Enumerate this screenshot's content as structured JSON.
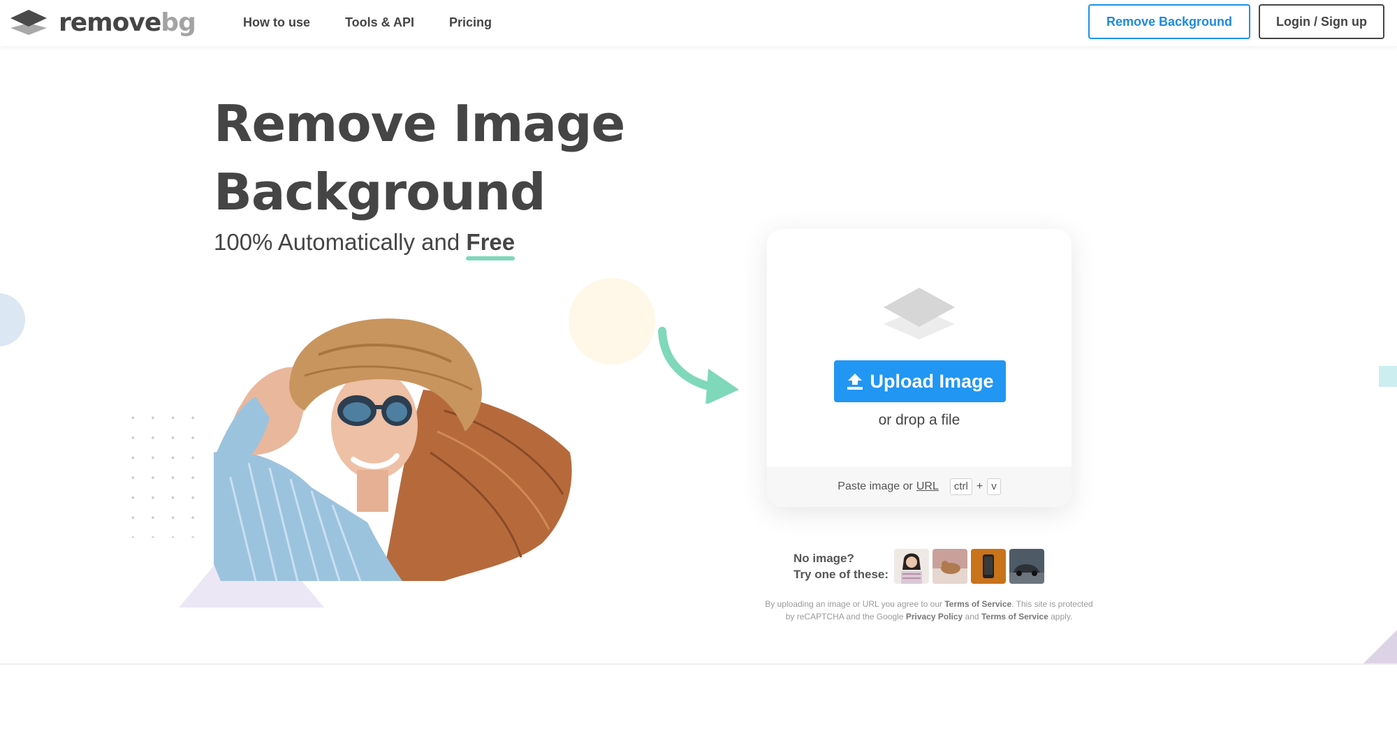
{
  "header": {
    "logo_main": "remove",
    "logo_accent": "bg",
    "nav": [
      "How to use",
      "Tools & API",
      "Pricing"
    ],
    "remove_bg_button": "Remove Background",
    "login_button": "Login / Sign up"
  },
  "hero": {
    "title_line1": "Remove Image",
    "title_line2": "Background",
    "subtitle_prefix": "100% Automatically and",
    "subtitle_emphasis": "Free"
  },
  "upload_card": {
    "upload_label": "Upload Image",
    "drop_text": "or drop a file",
    "paste_prefix": "Paste image or",
    "paste_url": "URL",
    "key_ctrl": "ctrl",
    "key_plus": "+",
    "key_v": "v"
  },
  "samples": {
    "line1": "No image?",
    "line2": "Try one of these:",
    "thumbs": [
      "woman-portrait",
      "animal-on-blanket",
      "phone-product",
      "car"
    ]
  },
  "legal": {
    "t1": "By uploading an image or URL you agree to our",
    "terms": "Terms of Service",
    "t2": ". This site is protected by reCAPTCHA and the Google",
    "privacy": "Privacy Policy",
    "t3": "and",
    "terms2": "Terms of Service",
    "t4": "apply."
  },
  "colors": {
    "accent_blue": "#2196f3",
    "text_dark": "#454545",
    "underline_green": "#7fd8ba"
  },
  "icons": [
    "logo-layers-icon",
    "layers-icon",
    "upload-icon",
    "curved-arrow-icon"
  ]
}
